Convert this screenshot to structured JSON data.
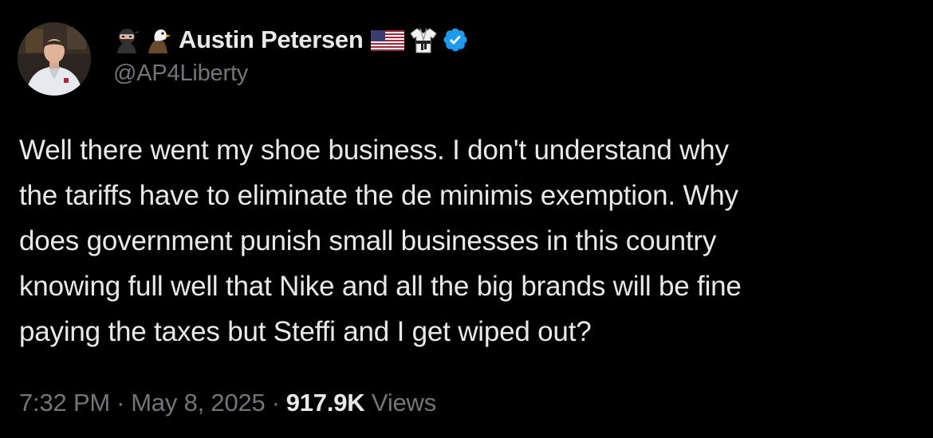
{
  "author": {
    "display_name": "Austin Petersen",
    "handle": "@AP4Liberty",
    "verified": true,
    "name_prefix_icons": [
      "ninja-icon",
      "eagle-icon"
    ],
    "name_suffix_icons": [
      "us-flag-icon",
      "martial-arts-uniform-icon",
      "verified-badge-icon"
    ]
  },
  "tweet": {
    "text_lines": [
      "Well there went my shoe business. I don't understand why",
      "the tariffs have to eliminate the de minimis exemption. Why",
      "does government punish small businesses in this country",
      "knowing full well that Nike and all the big brands will be fine",
      "paying the taxes but Steffi and I get wiped out?"
    ]
  },
  "meta": {
    "time": "7:32 PM",
    "separator": "·",
    "date": "May 8, 2025",
    "views_count": "917.9K",
    "views_label": "Views"
  },
  "colors": {
    "background": "#000000",
    "primary_text": "#e7e9ea",
    "secondary_text": "#71767b",
    "verified_blue": "#1d9bf0"
  }
}
